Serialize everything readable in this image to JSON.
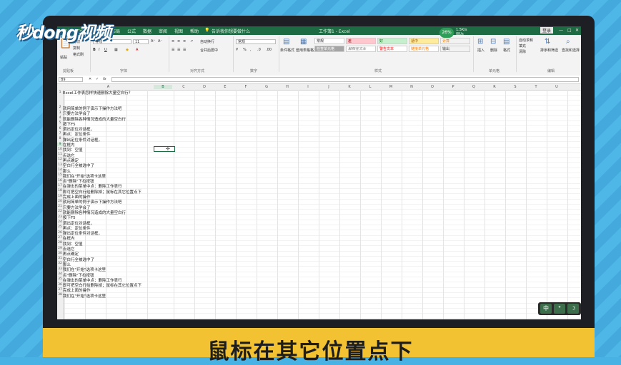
{
  "watermark": {
    "logo": "秒dong视频"
  },
  "titlebar": {
    "menus": [
      "文件",
      "开始",
      "插入",
      "页面布局",
      "公式",
      "数据",
      "审阅",
      "视图",
      "帮助"
    ],
    "tell_me": "告诉我你想要做什么",
    "doc_title": "工作簿1 - Excel",
    "login": "登录"
  },
  "status_widget": {
    "cpu": "26%",
    "up": "1.5K/s",
    "down": "0K/s"
  },
  "ribbon": {
    "paste": "粘贴",
    "cut": "剪切",
    "copy": "复制",
    "format_painter": "格式刷",
    "font_name": "等线",
    "font_size": "11",
    "wrap_text": "自动换行",
    "merge_center": "合并后居中",
    "number_format": "常规",
    "conditional_format": "条件格式",
    "table_format": "套用表格格式",
    "styles": [
      {
        "label": "常规",
        "bg": "#ffffff",
        "fg": "#222222"
      },
      {
        "label": "差",
        "bg": "#ffc7ce",
        "fg": "#9c0006"
      },
      {
        "label": "好",
        "bg": "#c6efce",
        "fg": "#006100"
      },
      {
        "label": "适中",
        "bg": "#ffeb9c",
        "fg": "#9c5700"
      },
      {
        "label": "计算",
        "bg": "#f2f2f2",
        "fg": "#fa7d00"
      },
      {
        "label": "检查单元格",
        "bg": "#a5a5a5",
        "fg": "#ffffff"
      },
      {
        "label": "解释性文本",
        "bg": "#ffffff",
        "fg": "#7f7f7f"
      },
      {
        "label": "警告文本",
        "bg": "#ffffff",
        "fg": "#ff0000"
      },
      {
        "label": "链接单元格",
        "bg": "#ffffff",
        "fg": "#fa7d00"
      },
      {
        "label": "输出",
        "bg": "#f2f2f2",
        "fg": "#3f3f3f"
      }
    ],
    "insert": "插入",
    "delete": "删除",
    "format": "格式",
    "autosum": "自动求和",
    "fill": "填充",
    "clear": "清除",
    "sort_filter": "排序和筛选",
    "find_select": "查找和选择",
    "groups": [
      "剪贴板",
      "字体",
      "对齐方式",
      "数字",
      "样式",
      "单元格",
      "编辑"
    ]
  },
  "formula_bar": {
    "name_box": "B9",
    "fx": "fx",
    "value": ""
  },
  "columns": [
    "A",
    "B",
    "C",
    "D",
    "E",
    "F",
    "G",
    "H",
    "I",
    "J",
    "K",
    "L",
    "M",
    "N",
    "O",
    "P",
    "Q",
    "R",
    "S",
    "T",
    "U"
  ],
  "rows": [
    {
      "num": "1",
      "text": "Excel工作表怎样快速删除大量空白行？"
    },
    {
      "num": "2",
      "text": "就用简单的例子演示下操作方法吧"
    },
    {
      "num": "3",
      "text": "只要方法学会了"
    },
    {
      "num": "4",
      "text": "就能删除各种情况造成的大量空白行"
    },
    {
      "num": "5",
      "text": "按下F5"
    },
    {
      "num": "6",
      "text": "调出定位对话框，"
    },
    {
      "num": "7",
      "text": "再点：定位条件"
    },
    {
      "num": "8",
      "text": "弹出定位条件对话框，"
    },
    {
      "num": "9",
      "text": "在框内"
    },
    {
      "num": "10",
      "text": "找到：空值"
    },
    {
      "num": "11",
      "text": "点选它"
    },
    {
      "num": "12",
      "text": "再点确定"
    },
    {
      "num": "13",
      "text": "空白行全被选中了"
    },
    {
      "num": "14",
      "text": "那么"
    },
    {
      "num": "15",
      "text": "我们在\"开始\"选项卡这里"
    },
    {
      "num": "16",
      "text": "点\"删除\"下拉按钮"
    },
    {
      "num": "17",
      "text": "在弹出的菜单中点：删除工作表行"
    },
    {
      "num": "18",
      "text": "即可把空白行给删除掉；鼠标在其它位置点下"
    },
    {
      "num": "19",
      "text": "完成上面的操作"
    },
    {
      "num": "20",
      "text": "就用简单的例子演示下操作方法吧"
    },
    {
      "num": "21",
      "text": "只要方法学会了"
    },
    {
      "num": "22",
      "text": "就能删除各种情况造成的大量空白行"
    },
    {
      "num": "23",
      "text": "按下F5"
    },
    {
      "num": "24",
      "text": "调出定位对话框，"
    },
    {
      "num": "25",
      "text": "再点：定位条件"
    },
    {
      "num": "26",
      "text": "弹出定位条件对话框，"
    },
    {
      "num": "27",
      "text": "在框内"
    },
    {
      "num": "28",
      "text": "找到：空值"
    },
    {
      "num": "29",
      "text": "点选它"
    },
    {
      "num": "30",
      "text": "再点确定"
    },
    {
      "num": "31",
      "text": "空白行全被选中了"
    },
    {
      "num": "32",
      "text": "那么"
    },
    {
      "num": "33",
      "text": "我们在\"开始\"选项卡这里"
    },
    {
      "num": "34",
      "text": "点\"删除\"下拉按钮"
    },
    {
      "num": "35",
      "text": "在弹出的菜单中点：删除工作表行"
    },
    {
      "num": "36",
      "text": "即可把空白行给删除掉；鼠标在其它位置点下"
    },
    {
      "num": "37",
      "text": "完成上面的操作"
    },
    {
      "num": "38",
      "text": "我们在\"开始\"选项卡这里"
    }
  ],
  "ime": {
    "lang": "中",
    "mode": "°",
    "moon": "☽"
  },
  "subtitle": "鼠标在其它位置点下"
}
